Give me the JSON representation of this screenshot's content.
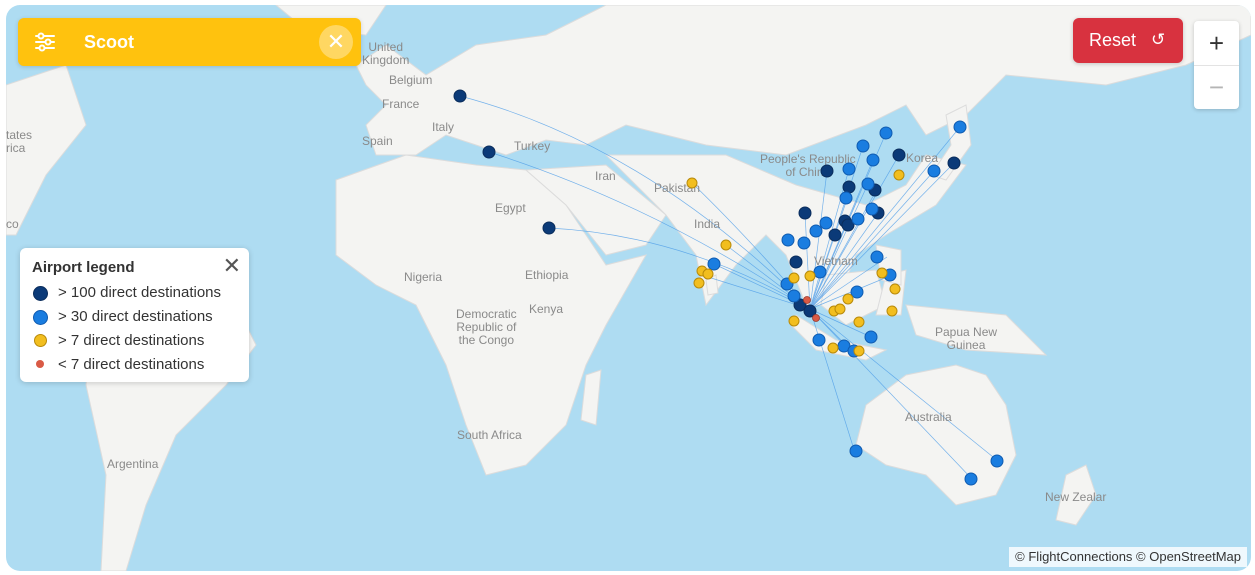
{
  "filter": {
    "label": "Scoot",
    "filter_icon": "sliders-icon",
    "close_glyph": "✕"
  },
  "controls": {
    "reset_label": "Reset",
    "reset_icon": "↺",
    "zoom_in": "+",
    "zoom_out": "−"
  },
  "legend": {
    "title": "Airport legend",
    "close_glyph": "✕",
    "items": [
      {
        "label": "> 100 direct destinations",
        "color": "#0b3a78"
      },
      {
        "label": "> 30 direct destinations",
        "color": "#1a7de0"
      },
      {
        "label": "> 7 direct destinations",
        "color": "#f2be1f"
      },
      {
        "label": "< 7 direct destinations",
        "color": "#d95a45"
      }
    ]
  },
  "map_labels": {
    "united_kingdom": "United\nKingdom",
    "belgium": "Belgium",
    "france": "France",
    "spain": "Spain",
    "italy": "Italy",
    "turkey": "Turkey",
    "iran": "Iran",
    "pakistan": "Pakistan",
    "india": "India",
    "egypt": "Egypt",
    "nigeria": "Nigeria",
    "ethiopia": "Ethiopia",
    "kenya": "Kenya",
    "drc": "Democratic\nRepublic of\nthe Congo",
    "south_africa": "South Africa",
    "argentina": "Argentina",
    "china": "People's Republic\nof China",
    "korea": "Korea",
    "vietnam": "Vietnam",
    "papua": "Papua New\nGuinea",
    "australia": "Australia",
    "new_zealand": "New Zealar",
    "states": "tates\nrica",
    "co": "co"
  },
  "attribution": "© FlightConnections © OpenStreetMap"
}
